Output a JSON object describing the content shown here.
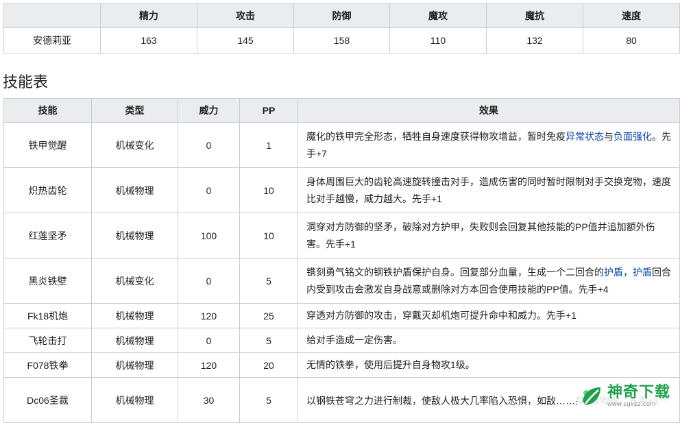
{
  "stats": {
    "headers": [
      "",
      "精力",
      "攻击",
      "防御",
      "魔攻",
      "魔抗",
      "速度"
    ],
    "row": [
      "安德莉亚",
      "163",
      "145",
      "158",
      "110",
      "132",
      "80"
    ]
  },
  "skills_title": "技能表",
  "skills": {
    "headers": [
      "技能",
      "类型",
      "威力",
      "PP",
      "效果"
    ],
    "rows": [
      {
        "name": "铁甲觉醒",
        "type": "机械变化",
        "power": "0",
        "pp": "1",
        "effect": [
          {
            "t": "魔化的铁甲完全形态，牺牲自身速度获得物攻增益，暂时免疫"
          },
          {
            "t": "异常状态",
            "link": true
          },
          {
            "t": "与"
          },
          {
            "t": "负面强化",
            "link": true
          },
          {
            "t": "。先手+7"
          }
        ]
      },
      {
        "name": "炽热齿轮",
        "type": "机械物理",
        "power": "0",
        "pp": "10",
        "effect": [
          {
            "t": "身体周围巨大的齿轮高速旋转撞击对手，造成伤害的同时暂时限制对手交换宠物，速度比对手越慢，威力越大。先手+1"
          }
        ]
      },
      {
        "name": "红莲坚矛",
        "type": "机械物理",
        "power": "100",
        "pp": "10",
        "effect": [
          {
            "t": "洞穿对方防御的坚矛，破除对方护甲，失败则会回复其他技能的PP值并追加额外伤害。先手+1"
          }
        ]
      },
      {
        "name": "黑炎铁壁",
        "type": "机械变化",
        "power": "0",
        "pp": "5",
        "effect": [
          {
            "t": "镌刻勇气铭文的钢铁护盾保护自身。回复部分血量，生成一个二回合的"
          },
          {
            "t": "护盾",
            "link": true
          },
          {
            "t": "，"
          },
          {
            "t": "护盾",
            "link": true
          },
          {
            "t": "回合内受到攻击会激发自身战意或删除对方本回合使用技能的PP值。先手+4"
          }
        ]
      },
      {
        "name": "Fk18机炮",
        "type": "机械物理",
        "power": "120",
        "pp": "25",
        "effect": [
          {
            "t": "穿透对方防御的攻击，穿戴灭却机炮可提升命中和威力。先手+1"
          }
        ]
      },
      {
        "name": "飞轮击打",
        "type": "机械物理",
        "power": "0",
        "pp": "5",
        "effect": [
          {
            "t": "给对手造成一定伤害。"
          }
        ]
      },
      {
        "name": "F078铁拳",
        "type": "机械物理",
        "power": "120",
        "pp": "20",
        "effect": [
          {
            "t": "无情的铁拳，使用后提升自身物攻1级。"
          }
        ]
      },
      {
        "name": "Dc06圣裁",
        "type": "机械物理",
        "power": "30",
        "pp": "5",
        "effect": [
          {
            "t": "以钢铁苍穹之力进行制裁，使敌人极大几率陷入恐惧，如敌……身2级物攻。先手+3"
          },
          {
            "t": "[4]",
            "ref": true
          }
        ]
      }
    ]
  },
  "watermark": {
    "brand": "神奇下载",
    "url": "www.sqxzz.com",
    "icon": "leaf-logo-icon"
  }
}
